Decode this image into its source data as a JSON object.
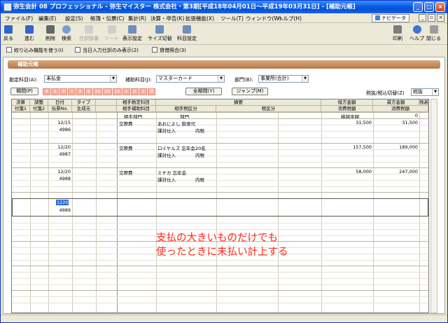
{
  "window": {
    "title": "弥生会計 08 プロフェッショナル - 弥生マイスター 株式会社・第3期[平成18年04月01日～平成19年03月31日] - [補助元帳]"
  },
  "menu": [
    "ファイル(F)",
    "編集(E)",
    "設定(S)",
    "帳簿・伝票(C)",
    "集計(R)",
    "決算・申告(K)",
    "拡張機能(X)",
    "ツール(T)",
    "ウィンドウ(W)",
    "ヘルプ(H)"
  ],
  "navi_label": "ナビゲータ",
  "toolbar": {
    "left": [
      "戻る",
      "進む",
      "削除",
      "検索",
      "仕訳辞書",
      "ソート",
      "表示設定",
      "サイズ切替",
      "科目設定"
    ],
    "right": [
      "印刷",
      "ヘルプ",
      "閉じる"
    ]
  },
  "options": [
    "絞り込み機能を使う(I)",
    "当日入力仕訳のみ表示(2)",
    "貸借照合(3)"
  ],
  "ledger": {
    "title": "補助元帳",
    "account_label": "勘定科目(A):",
    "account_value": "未払金",
    "sub_label": "補助科目(J):",
    "sub_value": "マスターカード",
    "dept_label": "部門(B):",
    "dept_value": "事業所(合計)",
    "period_btn": "期間(P)",
    "months": [
      "4",
      "5",
      "6",
      "7",
      "8",
      "9",
      "10",
      "11",
      "12",
      "1",
      "2",
      "3",
      "決"
    ],
    "full_period_btn": "全期間(Y)",
    "jump_btn": "ジャンプ(M)",
    "tax_label": "税抜/税込切替(Z)",
    "tax_value": "税抜"
  },
  "grid_headers": {
    "row1": [
      "決算",
      "調整",
      "日付",
      "タイプ",
      "相手勘定科目",
      "摘要",
      "借方金額",
      "貸方金額",
      "残高"
    ],
    "row2": [
      "付箋1",
      "付箋2",
      "伝票No.",
      "生成元",
      "相手補助科目",
      "相手税区分",
      "税区分",
      "消費税額",
      "消費税額"
    ],
    "row3": [
      "相手部門",
      "部門",
      "繰越金額",
      "0"
    ]
  },
  "rows": [
    {
      "date": "12/15",
      "no": "4986",
      "account": "交際費",
      "memo": "あおによし 飲食代",
      "tax_class": "課対仕入",
      "tax_type": "内税",
      "debit": "",
      "credit": "31,500",
      "balance": "31,500"
    },
    {
      "date": "12/20",
      "no": "4987",
      "account": "交際費",
      "memo": "ロイヤルズ 忘年会20名",
      "tax_class": "課対仕入",
      "tax_type": "内税",
      "debit": "",
      "credit": "157,500",
      "balance": "189,000"
    },
    {
      "date": "12/20",
      "no": "4988",
      "account": "交際費",
      "memo": "ミチカ 忘年会",
      "tax_class": "課対仕入",
      "tax_type": "内税",
      "debit": "",
      "credit": "58,000",
      "balance": "247,000"
    }
  ],
  "new_row": {
    "date": "1220",
    "no": "4989"
  },
  "annotation": {
    "line1": "支払の大きいものだけでも",
    "line2": "使ったときに未払い計上する"
  }
}
